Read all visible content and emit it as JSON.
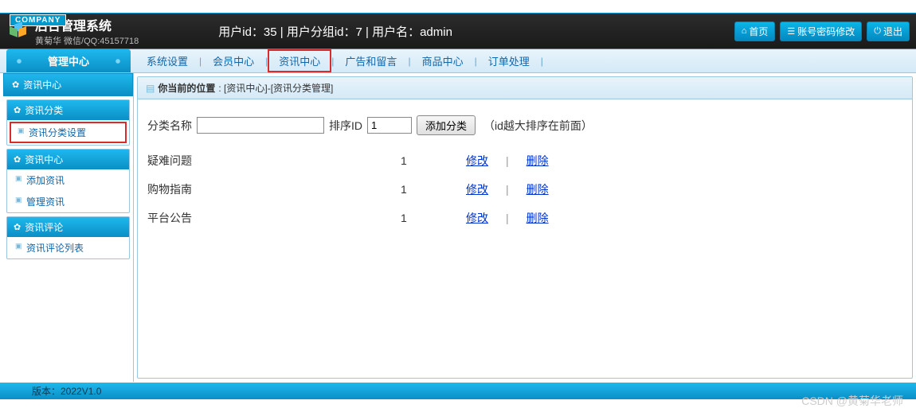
{
  "company_tag": "COMPANY",
  "header": {
    "title": "后台管理系统",
    "subtitle": "黄菊华 微信/QQ:45157718",
    "info": "用户id：35 | 用户分组id：7 | 用户名：admin",
    "home": "首页",
    "pwd": "账号密码修改",
    "logout": "退出"
  },
  "topnav": {
    "mgmt": "管理中心",
    "items": [
      "系统设置",
      "会员中心",
      "资讯中心",
      "广告和留言",
      "商品中心",
      "订单处理"
    ]
  },
  "sidebar": {
    "top": "资讯中心",
    "sections": [
      {
        "title": "资讯分类",
        "items": [
          {
            "label": "资讯分类设置",
            "boxed": true
          }
        ]
      },
      {
        "title": "资讯中心",
        "items": [
          {
            "label": "添加资讯"
          },
          {
            "label": "管理资讯"
          }
        ]
      },
      {
        "title": "资讯评论",
        "items": [
          {
            "label": "资讯评论列表"
          }
        ]
      }
    ]
  },
  "crumb": {
    "label": "你当前的位置",
    "path": ": [资讯中心]-[资讯分类管理]"
  },
  "form": {
    "name_label": "分类名称",
    "name_value": "",
    "sort_label": "排序ID",
    "sort_value": "1",
    "add_btn": "添加分类",
    "hint": "（id越大排序在前面）"
  },
  "rows": [
    {
      "name": "疑难问题",
      "sort": "1",
      "edit": "修改",
      "del": "删除"
    },
    {
      "name": "购物指南",
      "sort": "1",
      "edit": "修改",
      "del": "删除"
    },
    {
      "name": "平台公告",
      "sort": "1",
      "edit": "修改",
      "del": "删除"
    }
  ],
  "footer": "版本：2022V1.0",
  "watermark": "CSDN @黄菊华老师"
}
